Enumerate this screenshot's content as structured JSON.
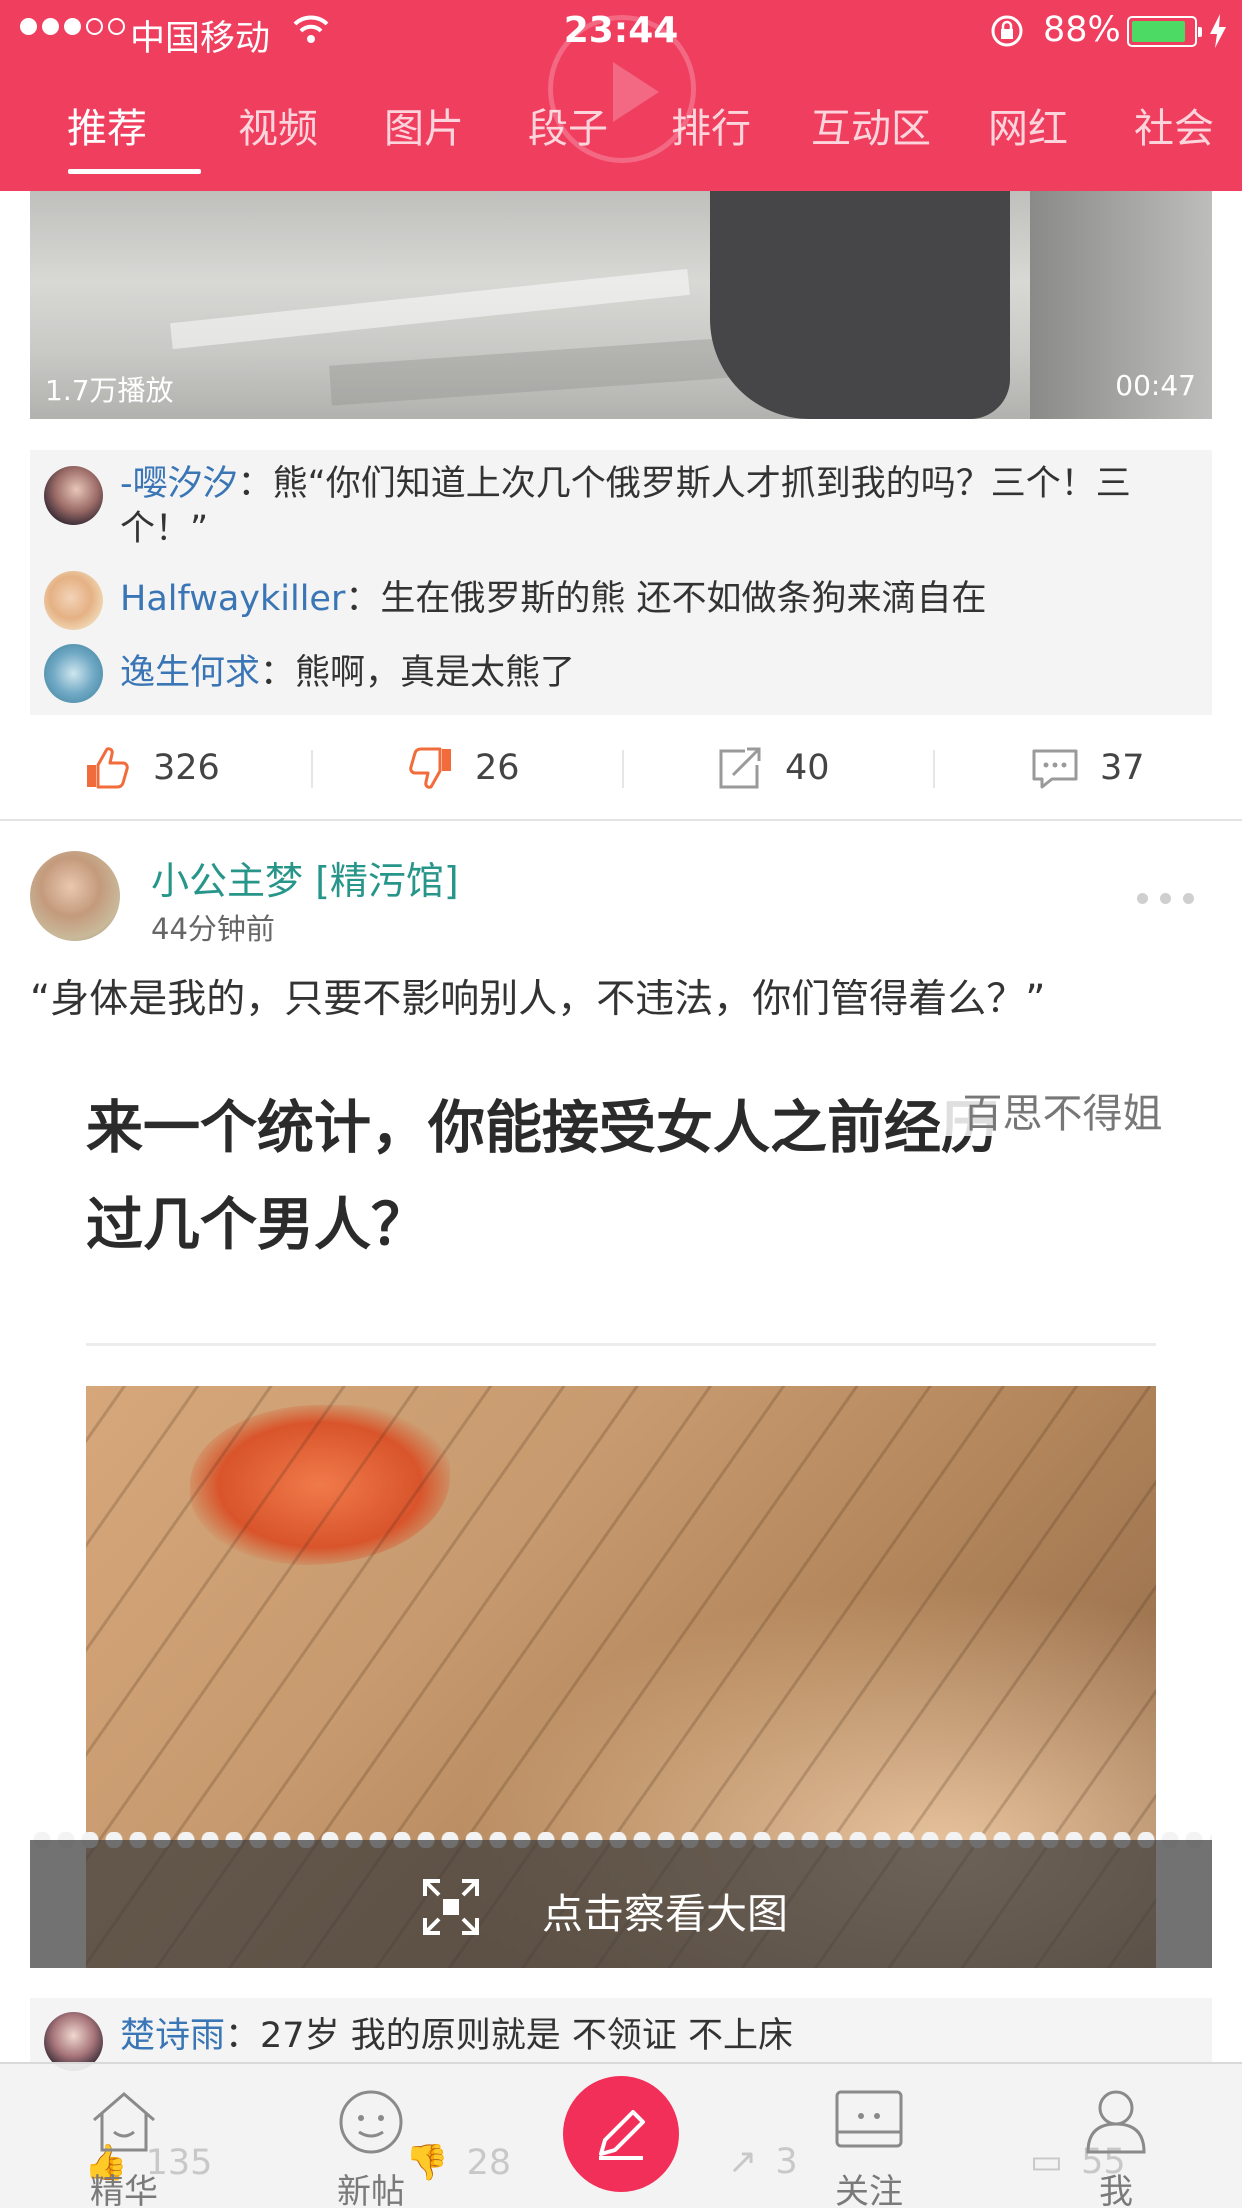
{
  "status_bar": {
    "carrier": "中国移动",
    "time": "23:44",
    "battery_percent": "88%",
    "battery_level": 0.88,
    "signal_bars_filled": 3,
    "signal_bars_total": 5
  },
  "tabs": [
    {
      "label": "推荐",
      "active": true
    },
    {
      "label": "视频",
      "active": false
    },
    {
      "label": "图片",
      "active": false
    },
    {
      "label": "段子",
      "active": false
    },
    {
      "label": "排行",
      "active": false
    },
    {
      "label": "互动区",
      "active": false
    },
    {
      "label": "网红",
      "active": false
    },
    {
      "label": "社会",
      "active": false
    }
  ],
  "post1": {
    "play_count": "1.7万播放",
    "duration": "00:47",
    "comments": [
      {
        "user": "-嘤汐汐",
        "sep": "：",
        "text": "熊“你们知道上次几个俄罗斯人才抓到我的吗？三个！三个！”"
      },
      {
        "user": "Halfwaykiller",
        "sep": "：",
        "text": "生在俄罗斯的熊 还不如做条狗来滴自在"
      },
      {
        "user": "逸生何求",
        "sep": "：",
        "text": "熊啊，真是太熊了"
      }
    ],
    "likes": "326",
    "dislikes": "26",
    "shares": "40",
    "comment_count": "37"
  },
  "post2": {
    "author": "小公主梦 [精污馆]",
    "time_ago": "44分钟前",
    "text": "“身体是我的，只要不影响别人，不违法，你们管得着么？”",
    "image_text_line1": "来一个统计，你能接受女人之前经历",
    "image_text_line2": "过几个男人？",
    "watermark": "百思不得姐",
    "view_large_label": "点击察看大图",
    "top_comment": {
      "user": "楚诗雨",
      "sep": "：",
      "text": "27岁 我的原则就是 不领证 不上床"
    },
    "likes": "135",
    "dislikes": "28",
    "shares": "3",
    "comment_count": "55"
  },
  "bottom_nav": [
    {
      "label": "精华",
      "icon": "home-icon"
    },
    {
      "label": "新帖",
      "icon": "smiley-icon"
    },
    {
      "label": "关注",
      "icon": "message-box-icon"
    },
    {
      "label": "我",
      "icon": "person-icon"
    }
  ],
  "colors": {
    "brand": "#ef385a",
    "username": "#3a76b5",
    "author": "#27958a",
    "compose": "#f12f58"
  }
}
